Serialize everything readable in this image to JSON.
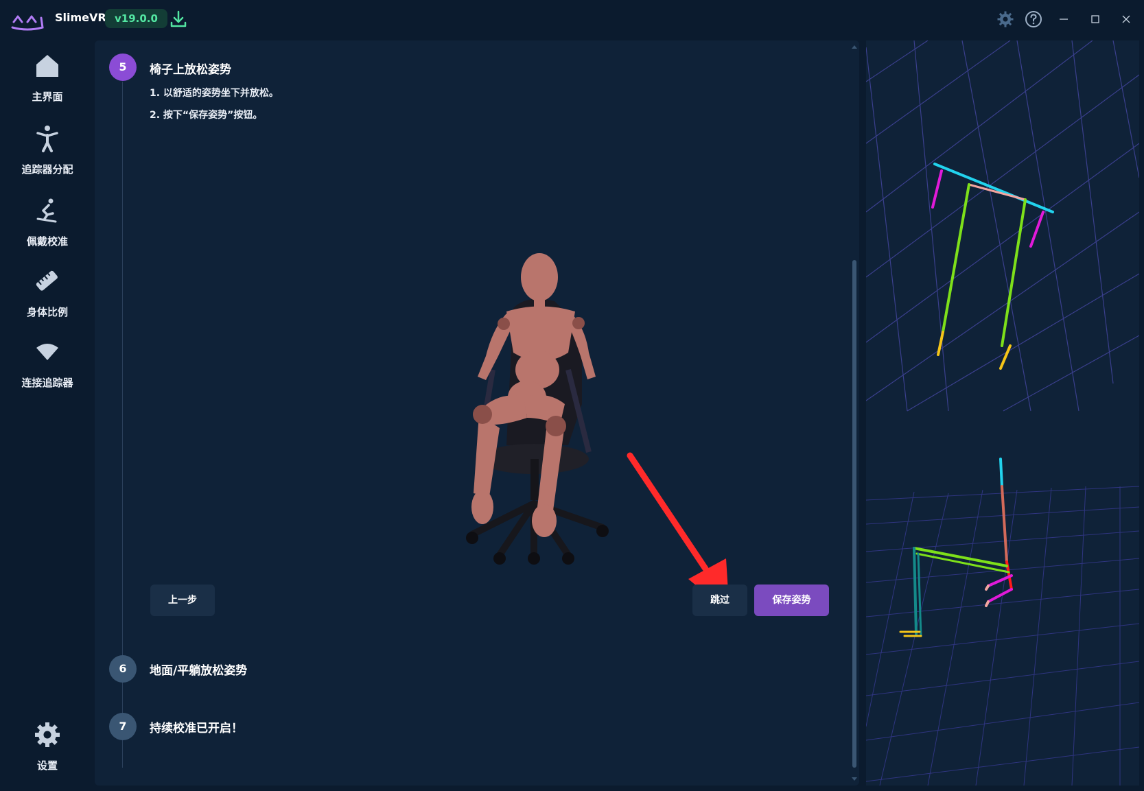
{
  "app": {
    "name": "SlimeVR",
    "version": "v19.0.0",
    "logo_icon": "slimevr-logo-icon",
    "download_icon": "download-icon",
    "settings_icon": "gear-icon",
    "help_icon": "help-icon"
  },
  "sidebar": {
    "items": [
      {
        "label": "主界面",
        "icon": "home-icon"
      },
      {
        "label": "追踪器分配",
        "icon": "person-icon"
      },
      {
        "label": "佩戴校准",
        "icon": "skier-icon"
      },
      {
        "label": "身体比例",
        "icon": "ruler-icon"
      },
      {
        "label": "连接追踪器",
        "icon": "wifi-icon"
      }
    ],
    "settings": {
      "label": "设置",
      "icon": "gear-icon"
    }
  },
  "steps": [
    {
      "number": "5",
      "title": "椅子上放松姿势",
      "active": true,
      "instructions": [
        "1. 以舒适的姿势坐下并放松。",
        "2. 按下“保存姿势”按钮。"
      ]
    },
    {
      "number": "6",
      "title": "地面/平躺放松姿势",
      "active": false
    },
    {
      "number": "7",
      "title": "持续校准已开启！",
      "active": false
    }
  ],
  "buttons": {
    "back": "上一步",
    "skip": "跳过",
    "save": "保存姿势"
  },
  "colors": {
    "background": "#0b1b2e",
    "panel": "#0f2238",
    "accent_purple": "#7b4bbf",
    "version_green": "#53e6a2"
  }
}
